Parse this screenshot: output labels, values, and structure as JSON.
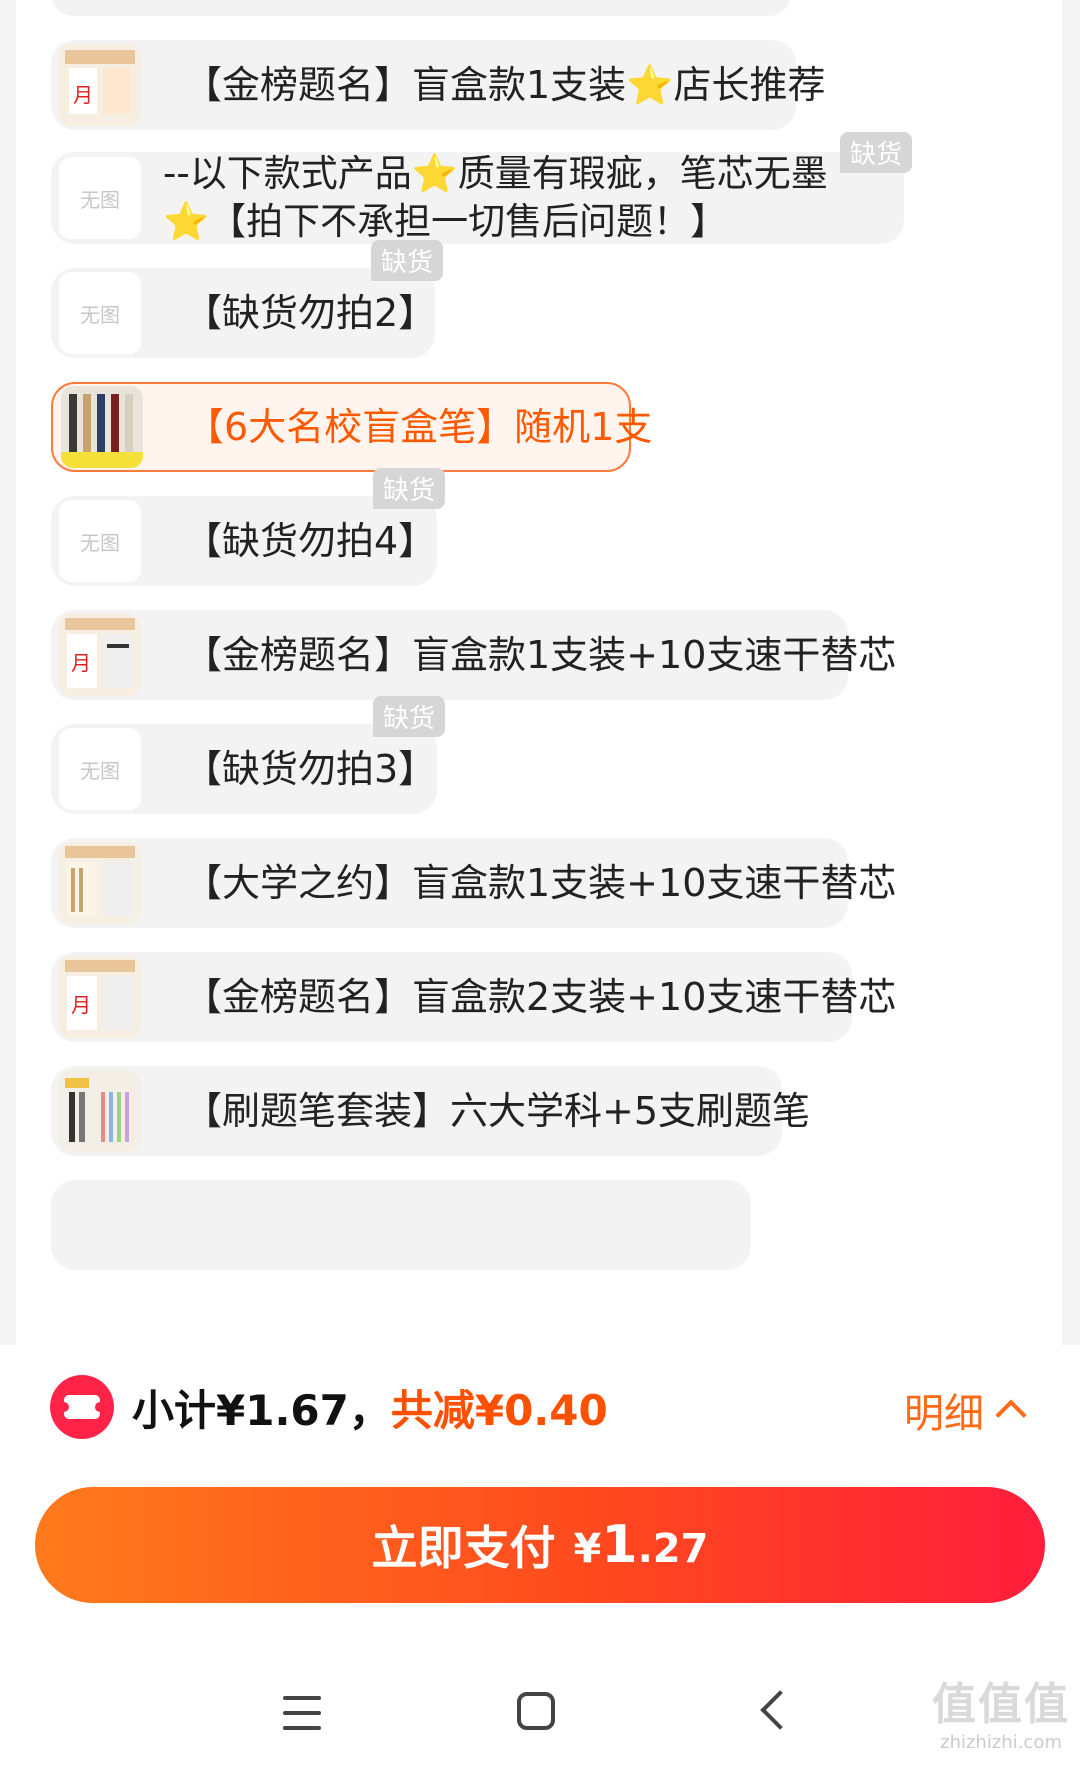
{
  "variants": [
    {
      "label": "【金榜题名】盲盒款1支装⭐店长推荐",
      "has_image": true
    },
    {
      "label": "--以下款式产品⭐质量有瑕疵，笔芯无墨⭐【拍下不承担一切售后问题！】",
      "no_image_text": "无图",
      "badge": "缺货"
    },
    {
      "label": "【缺货勿拍2】",
      "no_image_text": "无图",
      "badge": "缺货"
    },
    {
      "label": "【6大名校盲盒笔】随机1支",
      "has_image": true,
      "selected": true
    },
    {
      "label": "【缺货勿拍4】",
      "no_image_text": "无图",
      "badge": "缺货"
    },
    {
      "label": "【金榜题名】盲盒款1支装+10支速干替芯",
      "has_image": true
    },
    {
      "label": "【缺货勿拍3】",
      "no_image_text": "无图",
      "badge": "缺货"
    },
    {
      "label": "【大学之约】盲盒款1支装+10支速干替芯",
      "has_image": true
    },
    {
      "label": "【金榜题名】盲盒款2支装+10支速干替芯",
      "has_image": true
    },
    {
      "label": "【刷题笔套装】六大学科+5支刷题笔",
      "has_image": true
    }
  ],
  "footer": {
    "subtotal_label": "小计¥1.67，",
    "discount_label": "共减¥0.40",
    "detail_label": "明细",
    "pay_label": "立即支付",
    "pay_currency": "¥",
    "pay_int": "1",
    "pay_dec": ".27"
  },
  "watermark": {
    "main": "值值值",
    "sub": "zhizhizhi.com"
  },
  "colors": {
    "accent": "#ff5000",
    "coupon": "#ff2347",
    "selected_border": "#ff7a3d"
  }
}
